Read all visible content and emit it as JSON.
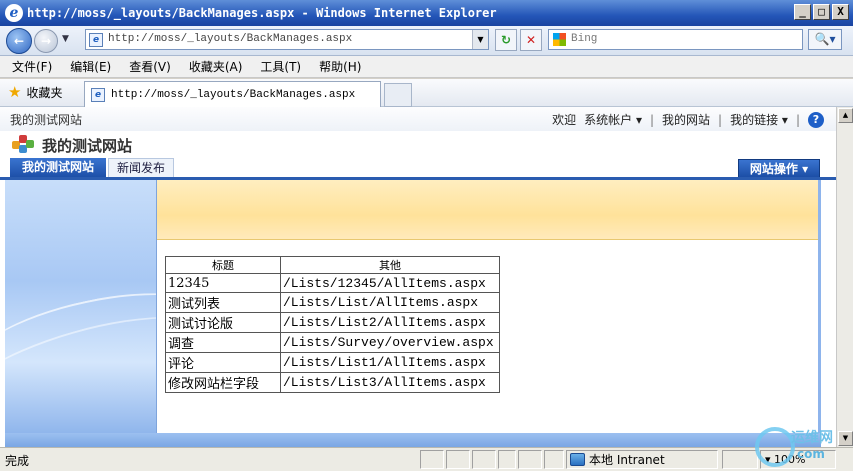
{
  "window": {
    "title": "http://moss/_layouts/BackManages.aspx - Windows Internet Explorer",
    "min_glyph": "_",
    "max_glyph": "□",
    "close_glyph": "X"
  },
  "address_bar": {
    "url": "http://moss/_layouts/BackManages.aspx",
    "search_placeholder": "Bing"
  },
  "menu": [
    "文件(F)",
    "编辑(E)",
    "查看(V)",
    "收藏夹(A)",
    "工具(T)",
    "帮助(H)"
  ],
  "favorites_bar": {
    "favorites_label": "收藏夹",
    "tab_title": "http://moss/_layouts/BackManages.aspx"
  },
  "sharepoint": {
    "site_label": "我的测试网站",
    "welcome": "欢迎",
    "user_menu": "系统帐户",
    "my_site": "我的网站",
    "my_links": "我的链接",
    "site_title": "我的测试网站",
    "tabs": [
      "我的测试网站",
      "新闻发布"
    ],
    "site_actions": "网站操作"
  },
  "lists_table": {
    "headers": [
      "标题",
      "其他"
    ],
    "rows": [
      [
        "12345",
        "/Lists/12345/AllItems.aspx"
      ],
      [
        "测试列表",
        "/Lists/List/AllItems.aspx"
      ],
      [
        "测试讨论版",
        "/Lists/List2/AllItems.aspx"
      ],
      [
        "调查",
        "/Lists/Survey/overview.aspx"
      ],
      [
        "评论",
        "/Lists/List1/AllItems.aspx"
      ],
      [
        "修改网站栏字段",
        "/Lists/List3/AllItems.aspx"
      ]
    ]
  },
  "status_bar": {
    "status": "完成",
    "zone": "本地 Intranet",
    "zoom": "100%"
  },
  "watermark": {
    "text": "运维网",
    "sub": "com"
  },
  "colors": {
    "ie_title": "#2456b8",
    "sp_tab": "#1c4ea6",
    "banner": "#ffe29a"
  }
}
